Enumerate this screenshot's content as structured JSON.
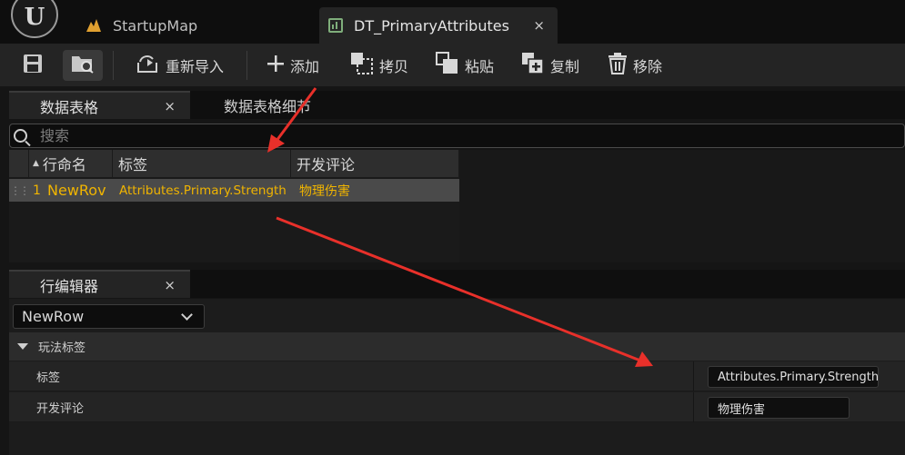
{
  "window": {
    "logo": "U",
    "tabs": [
      {
        "label": "StartupMap",
        "icon": "level-map-icon"
      },
      {
        "label": "DT_PrimaryAttributes",
        "icon": "data-table-icon",
        "active": true,
        "close": "×"
      }
    ]
  },
  "toolbar": {
    "reimport_label": "重新导入",
    "add_label": "添加",
    "copy_label": "拷贝",
    "paste_label": "粘贴",
    "duplicate_label": "复制",
    "remove_label": "移除"
  },
  "datatable_panel": {
    "tabs": [
      {
        "label": "数据表格",
        "active": true,
        "close": "×"
      },
      {
        "label": "数据表格细节"
      }
    ],
    "search_placeholder": "搜索",
    "columns": [
      "行命名",
      "标签",
      "开发评论"
    ],
    "rows": [
      {
        "index": "1",
        "name": "NewRov",
        "tag": "Attributes.Primary.Strength",
        "comment": "物理伤害"
      }
    ]
  },
  "row_editor": {
    "tab_label": "行编辑器",
    "close": "×",
    "selected_row": "NewRow",
    "category": "玩法标签",
    "properties": [
      {
        "label": "标签",
        "value": "Attributes.Primary.Strength"
      },
      {
        "label": "开发评论",
        "value": "物理伤害"
      }
    ]
  },
  "colors": {
    "accent_row_text": "#f0b400",
    "annotation_arrow": "#e8302a",
    "data_table_icon": "#7fae7b"
  }
}
